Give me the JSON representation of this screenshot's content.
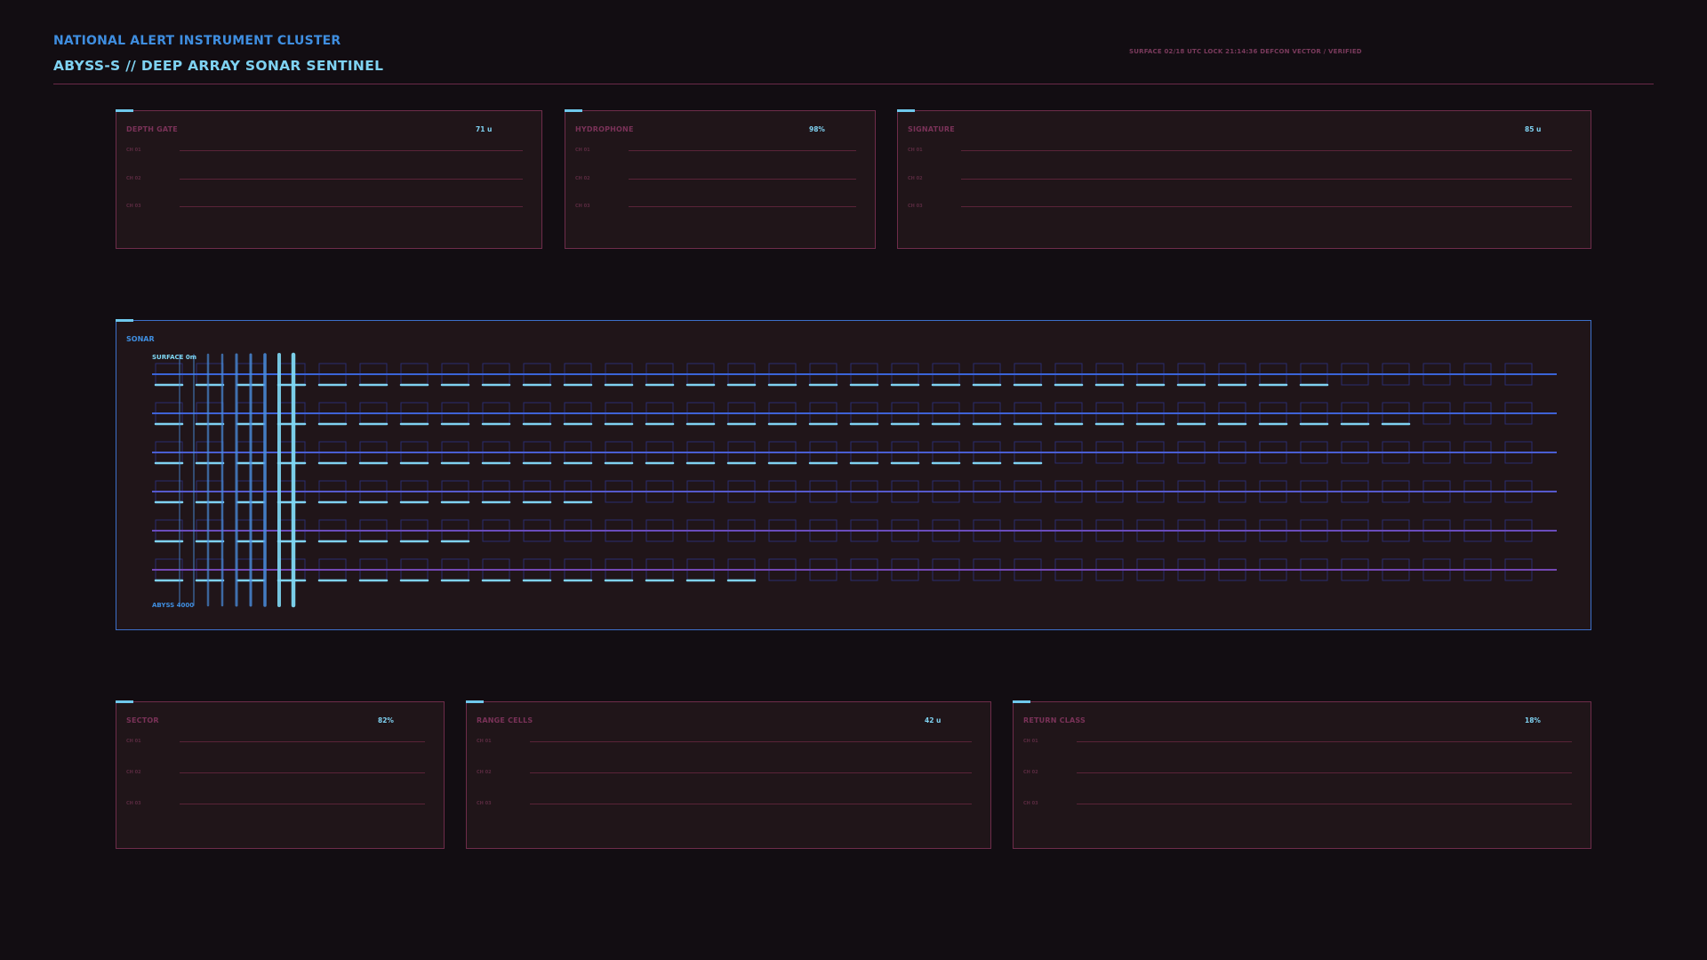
{
  "header": {
    "cluster_label": "NATIONAL ALERT INSTRUMENT CLUSTER",
    "title": "ABYSS-S  //  DEEP ARRAY SONAR SENTINEL",
    "status": "SURFACE 02/18   UTC LOCK  21:14:36   DEFCON VECTOR / VERIFIED"
  },
  "channel_labels": [
    "CH 01",
    "CH 02",
    "CH 03"
  ],
  "panels": {
    "depth_gate": {
      "title": "DEPTH GATE",
      "value": "71 u"
    },
    "hydrophone": {
      "title": "HYDROPHONE",
      "value": "98%"
    },
    "signature": {
      "title": "SIGNATURE",
      "value": "85 u"
    },
    "sector": {
      "title": "SECTOR",
      "value": "82%"
    },
    "range_cells": {
      "title": "RANGE CELLS",
      "value": "42 u"
    },
    "return_class": {
      "title": "RETURN CLASS",
      "value": "18%"
    }
  },
  "sonar": {
    "title": "SONAR",
    "surface_label": "SURFACE 0m",
    "abyss_label": "ABYSS 4000",
    "columns": 34,
    "rows": [
      {
        "lit_cells": 29,
        "color": "#3a64d8"
      },
      {
        "lit_cells": 31,
        "color": "#3f62d6"
      },
      {
        "lit_cells": 22,
        "color": "#4a5ed2"
      },
      {
        "lit_cells": 11,
        "color": "#5659cc"
      },
      {
        "lit_cells": 8,
        "color": "#6a4cbc"
      },
      {
        "lit_cells": 15,
        "color": "#7448b4"
      }
    ],
    "colors": {
      "dash": "#7fd2f2",
      "cell": "#2a2d6e",
      "bar": "#4a8fe0",
      "bar_bright": "#7fd8f4"
    }
  }
}
